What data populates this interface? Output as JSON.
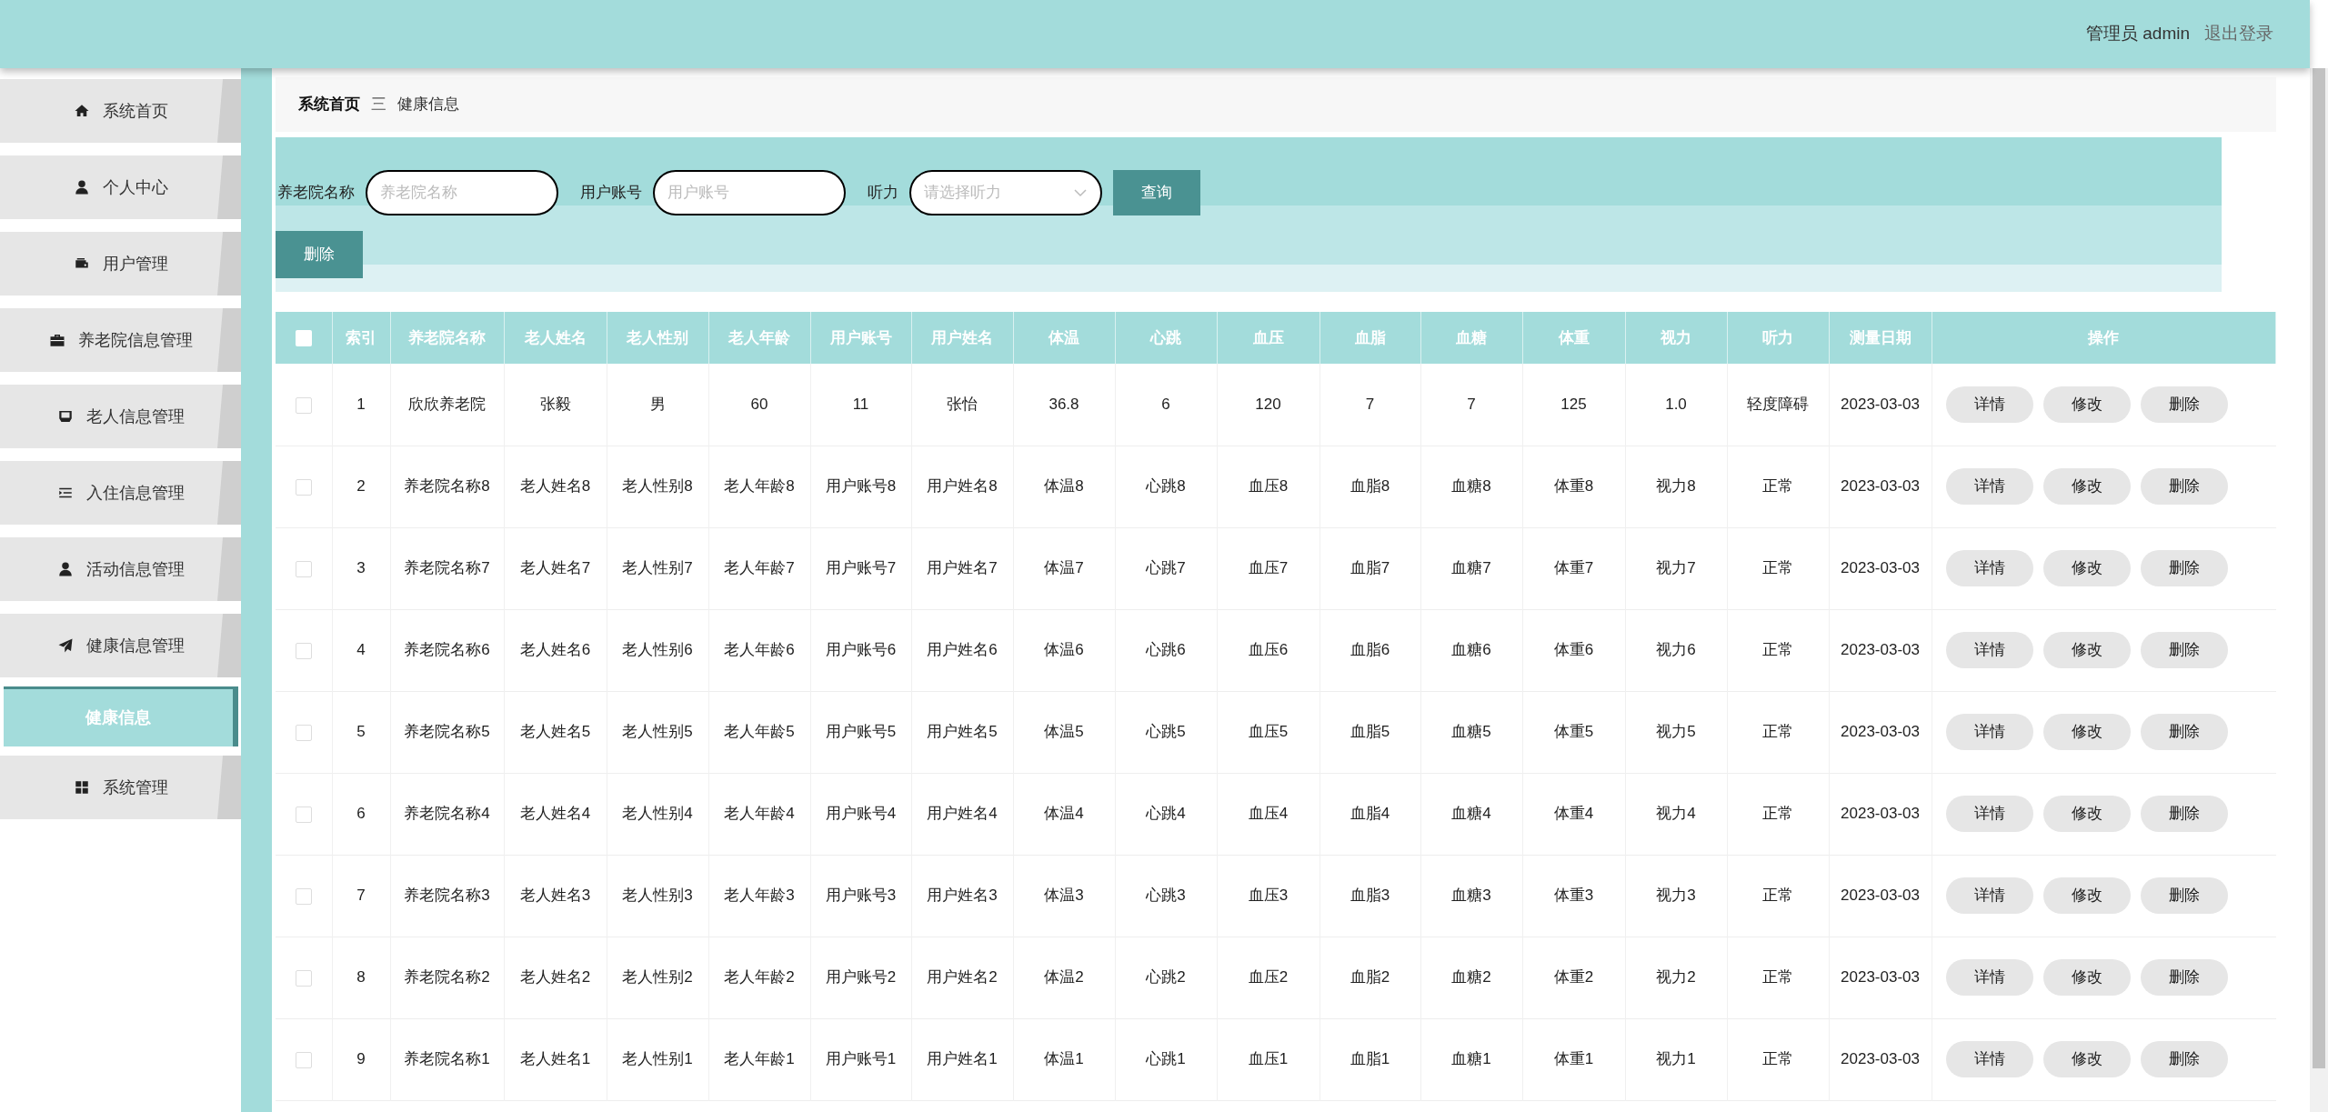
{
  "header": {
    "user": "管理员 admin",
    "logout": "退出登录"
  },
  "sidebar": {
    "items": [
      {
        "label": "系统首页",
        "selected": false
      },
      {
        "label": "个人中心",
        "selected": false
      },
      {
        "label": "用户管理",
        "selected": false
      },
      {
        "label": "养老院信息管理",
        "selected": false
      },
      {
        "label": "老人信息管理",
        "selected": false
      },
      {
        "label": "入住信息管理",
        "selected": false
      },
      {
        "label": "活动信息管理",
        "selected": false
      },
      {
        "label": "健康信息管理",
        "selected": false,
        "children": [
          {
            "label": "健康信息",
            "selected": true
          }
        ]
      },
      {
        "label": "系统管理",
        "selected": false
      }
    ]
  },
  "breadcrumb": {
    "items": [
      "系统首页",
      "健康信息"
    ],
    "separator": "三"
  },
  "search": {
    "fields": [
      {
        "label": "养老院名称",
        "kind": "text",
        "placeholder": "养老院名称"
      },
      {
        "label": "用户账号",
        "kind": "text",
        "placeholder": "用户账号"
      },
      {
        "label": "听力",
        "kind": "select",
        "placeholder": "请选择听力"
      }
    ],
    "button": "查询"
  },
  "toolbar": {
    "delete": "删除"
  },
  "table": {
    "select_all_checked": false,
    "columns": [
      "索引",
      "养老院名称",
      "老人姓名",
      "老人性别",
      "老人年龄",
      "用户账号",
      "用户姓名",
      "体温",
      "心跳",
      "血压",
      "血脂",
      "血糖",
      "体重",
      "视力",
      "听力",
      "测量日期",
      "操作"
    ],
    "rows": [
      {
        "checked": false,
        "cells": [
          "1",
          "欣欣养老院",
          "张毅",
          "男",
          "60",
          "11",
          "张怡",
          "36.8",
          "6",
          "120",
          "7",
          "7",
          "125",
          "1.0",
          "轻度障碍",
          "2023-03-03"
        ],
        "actions": [
          "详情",
          "修改",
          "删除"
        ]
      },
      {
        "checked": false,
        "cells": [
          "2",
          "养老院名称8",
          "老人姓名8",
          "老人性别8",
          "老人年龄8",
          "用户账号8",
          "用户姓名8",
          "体温8",
          "心跳8",
          "血压8",
          "血脂8",
          "血糖8",
          "体重8",
          "视力8",
          "正常",
          "2023-03-03"
        ],
        "actions": [
          "详情",
          "修改",
          "删除"
        ]
      },
      {
        "checked": false,
        "cells": [
          "3",
          "养老院名称7",
          "老人姓名7",
          "老人性别7",
          "老人年龄7",
          "用户账号7",
          "用户姓名7",
          "体温7",
          "心跳7",
          "血压7",
          "血脂7",
          "血糖7",
          "体重7",
          "视力7",
          "正常",
          "2023-03-03"
        ],
        "actions": [
          "详情",
          "修改",
          "删除"
        ]
      },
      {
        "checked": false,
        "cells": [
          "4",
          "养老院名称6",
          "老人姓名6",
          "老人性别6",
          "老人年龄6",
          "用户账号6",
          "用户姓名6",
          "体温6",
          "心跳6",
          "血压6",
          "血脂6",
          "血糖6",
          "体重6",
          "视力6",
          "正常",
          "2023-03-03"
        ],
        "actions": [
          "详情",
          "修改",
          "删除"
        ]
      },
      {
        "checked": false,
        "cells": [
          "5",
          "养老院名称5",
          "老人姓名5",
          "老人性别5",
          "老人年龄5",
          "用户账号5",
          "用户姓名5",
          "体温5",
          "心跳5",
          "血压5",
          "血脂5",
          "血糖5",
          "体重5",
          "视力5",
          "正常",
          "2023-03-03"
        ],
        "actions": [
          "详情",
          "修改",
          "删除"
        ]
      },
      {
        "checked": false,
        "cells": [
          "6",
          "养老院名称4",
          "老人姓名4",
          "老人性别4",
          "老人年龄4",
          "用户账号4",
          "用户姓名4",
          "体温4",
          "心跳4",
          "血压4",
          "血脂4",
          "血糖4",
          "体重4",
          "视力4",
          "正常",
          "2023-03-03"
        ],
        "actions": [
          "详情",
          "修改",
          "删除"
        ]
      },
      {
        "checked": false,
        "cells": [
          "7",
          "养老院名称3",
          "老人姓名3",
          "老人性别3",
          "老人年龄3",
          "用户账号3",
          "用户姓名3",
          "体温3",
          "心跳3",
          "血压3",
          "血脂3",
          "血糖3",
          "体重3",
          "视力3",
          "正常",
          "2023-03-03"
        ],
        "actions": [
          "详情",
          "修改",
          "删除"
        ]
      },
      {
        "checked": false,
        "cells": [
          "8",
          "养老院名称2",
          "老人姓名2",
          "老人性别2",
          "老人年龄2",
          "用户账号2",
          "用户姓名2",
          "体温2",
          "心跳2",
          "血压2",
          "血脂2",
          "血糖2",
          "体重2",
          "视力2",
          "正常",
          "2023-03-03"
        ],
        "actions": [
          "详情",
          "修改",
          "删除"
        ]
      },
      {
        "checked": false,
        "cells": [
          "9",
          "养老院名称1",
          "老人姓名1",
          "老人性别1",
          "老人年龄1",
          "用户账号1",
          "用户姓名1",
          "体温1",
          "心跳1",
          "血压1",
          "血脂1",
          "血糖1",
          "体重1",
          "视力1",
          "正常",
          "2023-03-03"
        ],
        "actions": [
          "详情",
          "修改",
          "删除"
        ]
      }
    ]
  }
}
